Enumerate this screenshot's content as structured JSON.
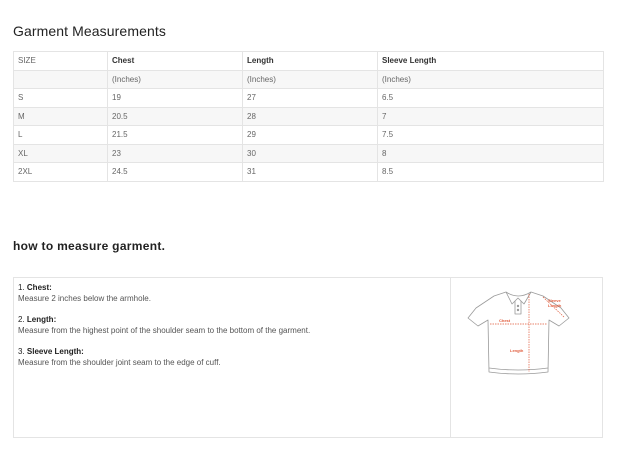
{
  "title": "Garment Measurements",
  "table": {
    "headers": [
      "SIZE",
      "Chest",
      "Length",
      "Sleeve Length"
    ],
    "units": [
      "",
      "(Inches)",
      "(Inches)",
      "(Inches)"
    ],
    "rows": [
      [
        "S",
        "19",
        "27",
        "6.5"
      ],
      [
        "M",
        "20.5",
        "28",
        "7"
      ],
      [
        "L",
        "21.5",
        "29",
        "7.5"
      ],
      [
        "XL",
        "23",
        "30",
        "8"
      ],
      [
        "2XL",
        "24.5",
        "31",
        "8.5"
      ]
    ]
  },
  "howto": {
    "title": "how to measure garment.",
    "steps": [
      {
        "num": "1.",
        "label": "Chest:",
        "text": "Measure 2 inches below the armhole."
      },
      {
        "num": "2.",
        "label": "Length:",
        "text": "Measure from the highest point of the shoulder seam to the bottom of the garment."
      },
      {
        "num": "3.",
        "label": "Sleeve Length:",
        "text": "Measure from the shoulder joint seam to the edge of cuff."
      }
    ],
    "diagram": {
      "sleeve_label_1": "Sleeve",
      "sleeve_label_2": "Length",
      "chest_label": "Chest",
      "length_label": "Length",
      "accent_color": "#e05a3a",
      "outline_color": "#9a9a9a"
    }
  }
}
